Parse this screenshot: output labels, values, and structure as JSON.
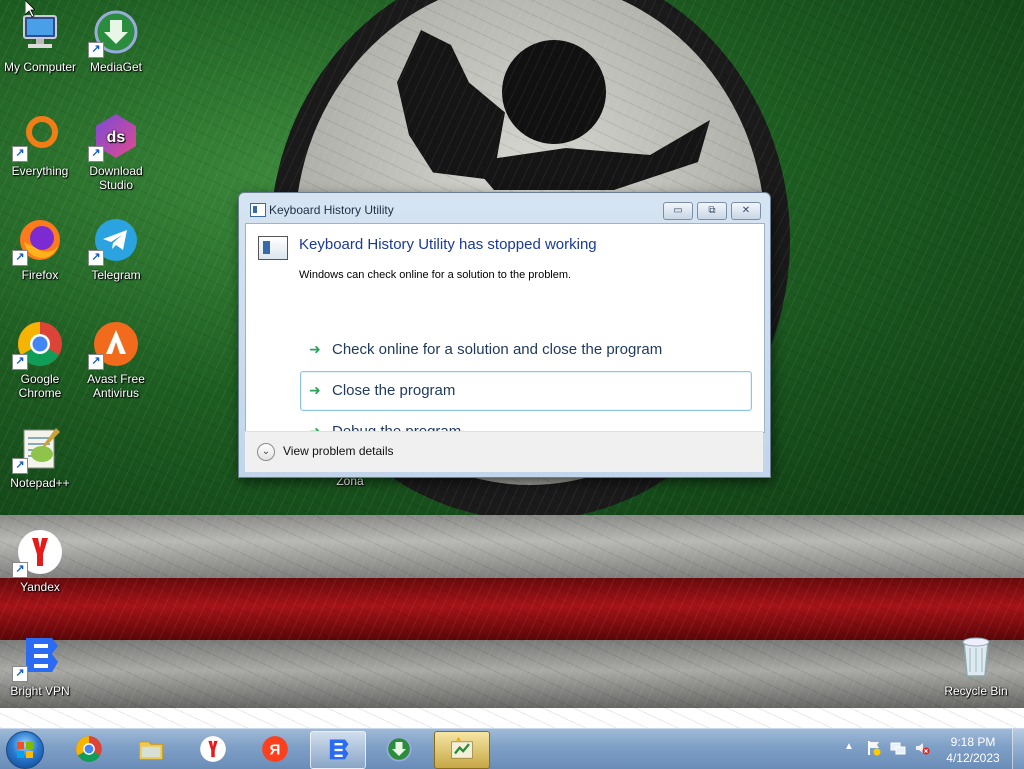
{
  "desktop": {
    "icons": [
      {
        "label": "My Computer"
      },
      {
        "label": "MediaGet"
      },
      {
        "label": "Everything"
      },
      {
        "label": "Download Studio"
      },
      {
        "label": "Firefox"
      },
      {
        "label": "Telegram"
      },
      {
        "label": "Google Chrome"
      },
      {
        "label": "Avast Free Antivirus"
      },
      {
        "label": "Notepad++"
      },
      {
        "label": "Zona"
      },
      {
        "label": "Yandex"
      },
      {
        "label": "Bright VPN"
      },
      {
        "label": "Recycle Bin"
      }
    ]
  },
  "dialog": {
    "title": "Keyboard History Utility",
    "minimize_glyph": "▭",
    "maximize_glyph": "⧉",
    "close_glyph": "✕",
    "main_instruction": "Keyboard History Utility has stopped working",
    "sub_instruction": "Windows can check online for a solution to the problem.",
    "commands": [
      {
        "label": "Check online for a solution and close the program"
      },
      {
        "label": "Close the program"
      },
      {
        "label": "Debug the program"
      }
    ],
    "details_label": "View problem details"
  },
  "taskbar": {
    "clock_time": "9:18 PM",
    "clock_date": "4/12/2023",
    "apps": [
      "chrome-icon",
      "explorer-icon",
      "yandex-browser-icon",
      "yandex-icon",
      "bright-vpn-icon",
      "mediaget-icon",
      "keyboard-history-icon"
    ]
  },
  "colors": {
    "accent": "#1a3a9c",
    "command_arrow": "#2aa35a",
    "taskbar": "#7e9fc6"
  }
}
